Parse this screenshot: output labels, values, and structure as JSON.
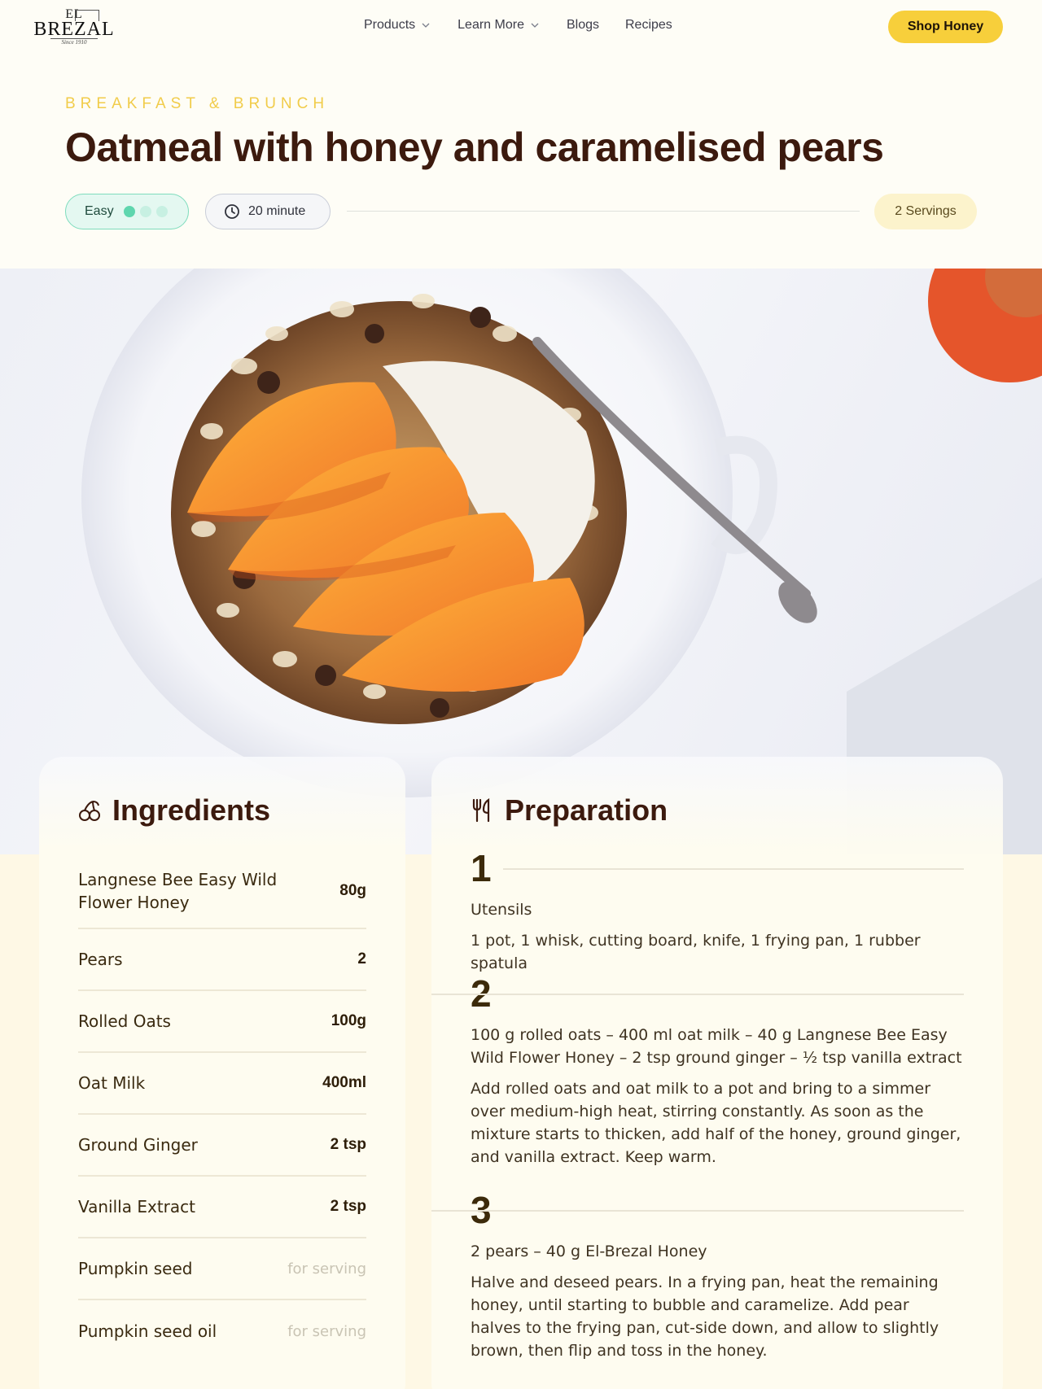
{
  "nav": {
    "logo": {
      "top": "EL",
      "main": "BREZAL",
      "since": "Since 1910"
    },
    "links": [
      {
        "label": "Products",
        "has_dropdown": true
      },
      {
        "label": "Learn More",
        "has_dropdown": true
      },
      {
        "label": "Blogs",
        "has_dropdown": false
      },
      {
        "label": "Recipes",
        "has_dropdown": false
      }
    ],
    "cta": "Shop Honey"
  },
  "recipe": {
    "category": "BREAKFAST & BRUNCH",
    "title": "Oatmeal with honey and caramelised pears",
    "difficulty": {
      "label": "Easy",
      "level": 1,
      "max": 3
    },
    "time": "20 minute",
    "servings": "2 Servings"
  },
  "ingredients": {
    "title": "Ingredients",
    "items": [
      {
        "name": "Langnese Bee Easy Wild Flower Honey",
        "qty": "80g"
      },
      {
        "name": "Pears",
        "qty": "2"
      },
      {
        "name": "Rolled Oats",
        "qty": "100g"
      },
      {
        "name": "Oat Milk",
        "qty": "400ml"
      },
      {
        "name": "Ground Ginger",
        "qty": "2 tsp"
      },
      {
        "name": "Vanilla Extract",
        "qty": "2 tsp"
      },
      {
        "name": "Pumpkin seed",
        "qty": "for serving"
      },
      {
        "name": "Pumpkin seed oil",
        "qty": "for serving"
      }
    ]
  },
  "preparation": {
    "title": "Preparation",
    "steps": [
      {
        "num": "1",
        "sub": "Utensils",
        "text": "1 pot, 1 whisk, cutting board, knife, 1 frying pan, 1 rubber spatula"
      },
      {
        "num": "2",
        "sub": "100 g rolled oats – 400 ml oat milk – 40 g Langnese Bee Easy Wild Flower Honey – 2 tsp ground ginger – ½ tsp vanilla extract",
        "text": "Add rolled oats and oat milk to a pot and bring to a simmer over medium-high heat, stirring constantly. As soon as the mixture starts to thicken, add half of the honey, ground ginger, and vanilla extract. Keep warm."
      },
      {
        "num": "3",
        "sub": "2 pears – 40 g El-Brezal Honey",
        "text": "Halve and deseed pears. In a frying pan, heat the remaining honey, until starting to bubble and caramelize. Add pear halves to the frying pan, cut-side down, and allow to slightly brown, then flip and toss in the honey."
      }
    ]
  },
  "colors": {
    "accent": "#f7cf3b",
    "title": "#3c1a0e",
    "easy_bg": "#e4f8f1",
    "easy_dot": "#5fd6ae",
    "servings_bg": "#fcf3cc",
    "cream": "#fef8e5"
  },
  "icons": {
    "nav_dropdown": "chevron-down-icon",
    "time": "clock-icon",
    "ingredients": "cherries-icon",
    "preparation": "utensils-icon"
  }
}
